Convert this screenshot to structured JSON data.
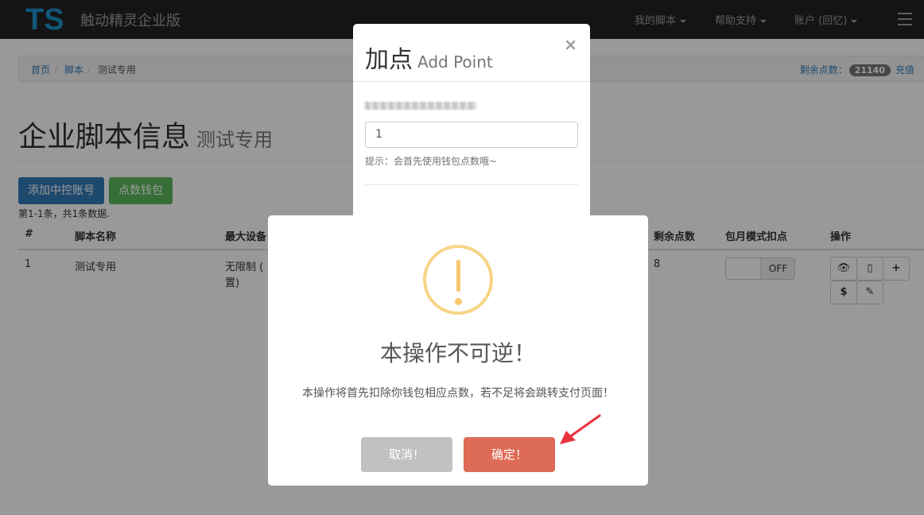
{
  "navbar": {
    "logo_text": "TS",
    "brand": "触动精灵企业版",
    "items": [
      {
        "label": "我的脚本"
      },
      {
        "label": "帮助支持"
      },
      {
        "label": "账户 (回忆)"
      }
    ]
  },
  "breadcrumb": {
    "items": [
      "首页",
      "脚本",
      "测试专用"
    ],
    "points_label": "剩余点数：",
    "points_value": "21140",
    "recharge": "充值"
  },
  "page": {
    "title": "企业脚本信息",
    "subtitle": "测试专用",
    "add_account_button": "添加中控账号",
    "wallet_button": "点数钱包",
    "summary": "第1-1条，共1条数据."
  },
  "table": {
    "headers": [
      "#",
      "脚本名称",
      "最大设备",
      "剩余点数",
      "包月模式扣点",
      "操作"
    ],
    "rows": [
      {
        "index": "1",
        "name": "测试专用",
        "max_devices": "无限制 (",
        "max_devices_line2": "置)",
        "remaining": "8",
        "toggle": "OFF"
      }
    ],
    "action_icons": [
      "eye-icon",
      "phone-icon",
      "plus-icon",
      "dollar-icon",
      "pencil-icon"
    ]
  },
  "add_point_modal": {
    "title": "加点",
    "title_en": "Add Point",
    "close": "×",
    "input_value": "1",
    "hint": "提示：会首先使用钱包点数哦~"
  },
  "alert": {
    "title": "本操作不可逆！",
    "text": "本操作将首先扣除你钱包相应点数，若不足将会跳转支付页面！",
    "cancel": "取消！",
    "confirm": "确定！"
  },
  "colors": {
    "navbar": "#222222",
    "primary": "#337ab7",
    "success": "#5cb85c",
    "confirm": "#dd6b55",
    "cancel": "#c1c1c1",
    "warning_icon": "#f8d486",
    "annotation_arrow": "#e8323c"
  }
}
